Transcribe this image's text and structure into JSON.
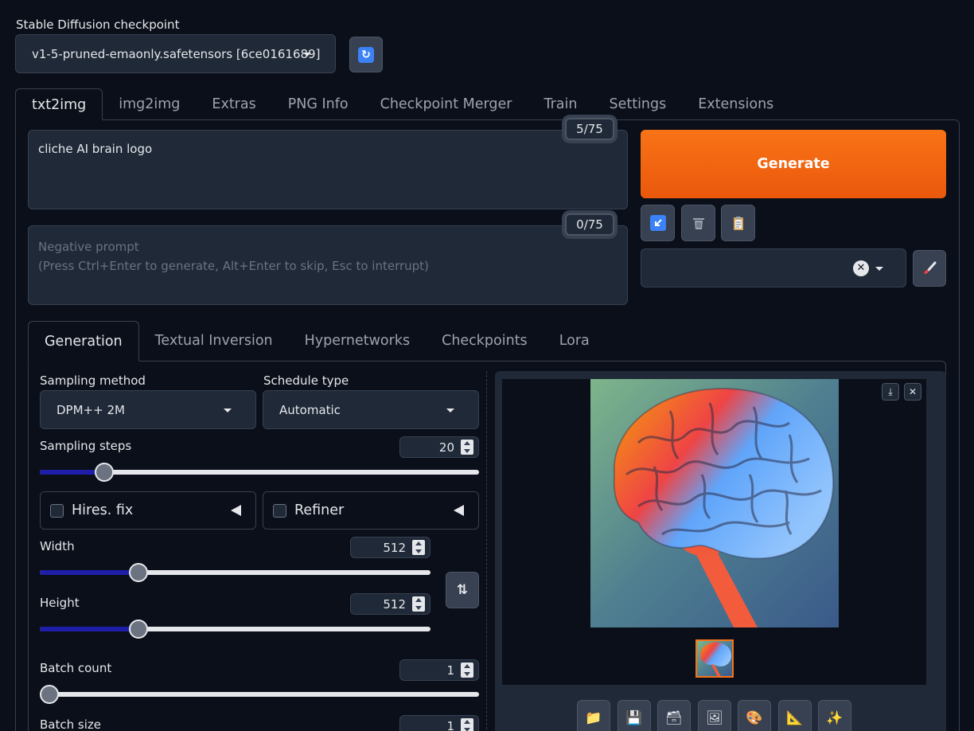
{
  "checkpoint": {
    "label": "Stable Diffusion checkpoint",
    "value": "v1-5-pruned-emaonly.safetensors [6ce0161689]"
  },
  "top_tabs": [
    "txt2img",
    "img2img",
    "Extras",
    "PNG Info",
    "Checkpoint Merger",
    "Train",
    "Settings",
    "Extensions"
  ],
  "prompt": {
    "text": "cliche AI brain logo",
    "counter": "5/75"
  },
  "negative_prompt": {
    "placeholder_line1": "Negative prompt",
    "placeholder_line2": "(Press Ctrl+Enter to generate, Alt+Enter to skip, Esc to interrupt)",
    "counter": "0/75"
  },
  "generate_label": "Generate",
  "sub_tabs": [
    "Generation",
    "Textual Inversion",
    "Hypernetworks",
    "Checkpoints",
    "Lora"
  ],
  "sampling_method": {
    "label": "Sampling method",
    "value": "DPM++ 2M"
  },
  "schedule_type": {
    "label": "Schedule type",
    "value": "Automatic"
  },
  "sampling_steps": {
    "label": "Sampling steps",
    "value": "20",
    "fraction": 0.13
  },
  "hires_fix": {
    "label": "Hires. fix"
  },
  "refiner": {
    "label": "Refiner"
  },
  "width": {
    "label": "Width",
    "value": "512",
    "fraction": 0.24
  },
  "height": {
    "label": "Height",
    "value": "512",
    "fraction": 0.24
  },
  "batch_count": {
    "label": "Batch count",
    "value": "1",
    "fraction": 0.0
  },
  "batch_size": {
    "label": "Batch size",
    "value": "1"
  },
  "colors": {
    "accent": "#f97316",
    "background": "#0b0f19",
    "panel": "#1f2937",
    "slider_fill": "#1e1ea8"
  },
  "icons": {
    "refresh": "refresh-icon",
    "tools": [
      "arrow-icon",
      "trash-icon",
      "clipboard-icon"
    ],
    "style_apply": "paintbrush-icon",
    "swap": "swap-icon",
    "gallery_actions": [
      "download-icon",
      "close-icon"
    ],
    "bottom": [
      "folder-icon",
      "save-icon",
      "zip-icon",
      "image-icon",
      "palette-icon",
      "ruler-icon",
      "sparkle-icon"
    ]
  }
}
